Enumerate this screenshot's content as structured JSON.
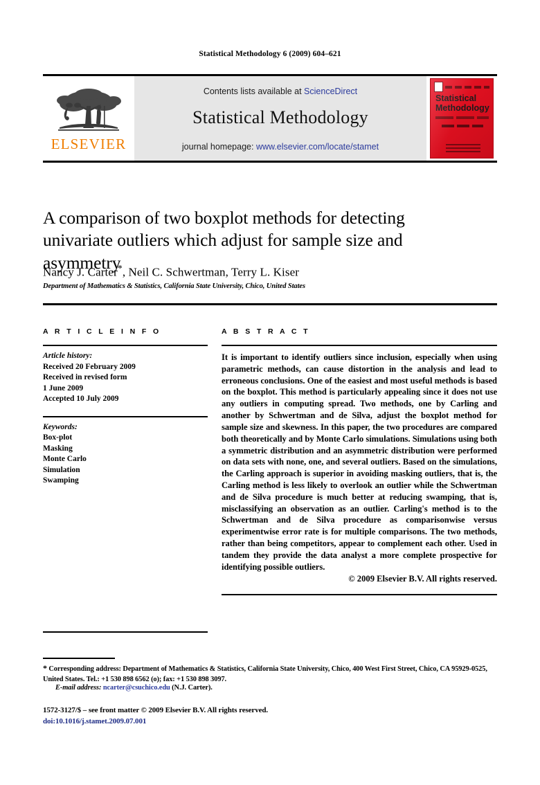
{
  "running_head": "Statistical Methodology 6 (2009) 604–621",
  "masthead": {
    "publisher_name": "ELSEVIER",
    "publisher_logo_icon": "elsevier-tree-icon",
    "contents_prefix": "Contents lists available at ",
    "contents_link": "ScienceDirect",
    "journal_name": "Statistical Methodology",
    "homepage_prefix": "journal homepage: ",
    "homepage_url": "www.elsevier.com/locate/stamet",
    "cover": {
      "title_line1": "Statistical",
      "title_line2": "Methodology"
    }
  },
  "article": {
    "title": "A comparison of two boxplot methods for detecting univariate outliers which adjust for sample size and asymmetry",
    "authors": "Nancy J. Carter",
    "authors_star": "*",
    "authors_rest": ", Neil C. Schwertman, Terry L. Kiser",
    "affiliation": "Department of Mathematics & Statistics, California State University, Chico, United States"
  },
  "info": {
    "heading": "A R T I C L E    I N F O",
    "history_label": "Article history:",
    "history": [
      "Received 20 February 2009",
      "Received in revised form",
      "1 June 2009",
      "Accepted 10 July 2009"
    ],
    "keywords_label": "Keywords:",
    "keywords": [
      "Box-plot",
      "Masking",
      "Monte Carlo",
      "Simulation",
      "Swamping"
    ]
  },
  "abstract": {
    "heading": "A B S T R A C T",
    "text": "It is important to identify outliers since inclusion, especially when using parametric methods, can cause distortion in the analysis and lead to erroneous conclusions. One of the easiest and most useful methods is based on the boxplot. This method is particularly appealing since it does not use any outliers in computing spread. Two methods, one by Carling and another by Schwertman and de Silva, adjust the boxplot method for sample size and skewness. In this paper, the two procedures are compared both theoretically and by Monte Carlo simulations. Simulations using both a symmetric distribution and an asymmetric distribution were performed on data sets with none, one, and several outliers. Based on the simulations, the Carling approach is superior in avoiding masking outliers, that is, the Carling method is less likely to overlook an outlier while the Schwertman and de Silva procedure is much better at reducing swamping, that is, misclassifying an observation as an outlier. Carling's method is to the Schwertman and de Silva procedure as comparisonwise versus experimentwise error rate is for multiple comparisons. The two methods, rather than being competitors, appear to complement each other. Used in tandem they provide the data analyst a more complete prospective for identifying possible outliers.",
    "copyright": "© 2009 Elsevier B.V. All rights reserved."
  },
  "footer": {
    "corresponding_star": "*",
    "corresponding_text": " Corresponding address: Department of Mathematics & Statistics, California State University, Chico, 400 West First Street, Chico, CA 95929-0525, United States. Tel.: +1 530 898 6562 (o); fax: +1 530 898 3097.",
    "email_label": "E-mail address:",
    "email": "ncarter@csuchico.edu",
    "email_suffix": " (N.J. Carter).",
    "issn_line": "1572-3127/$ – see front matter © 2009 Elsevier B.V. All rights reserved.",
    "doi_line": "doi:10.1016/j.stamet.2009.07.001"
  },
  "colors": {
    "link_blue": "#2b3a9c",
    "elsevier_orange": "#ef7d00",
    "cover_red": "#de1020",
    "masthead_grey": "#e6e6e6"
  }
}
